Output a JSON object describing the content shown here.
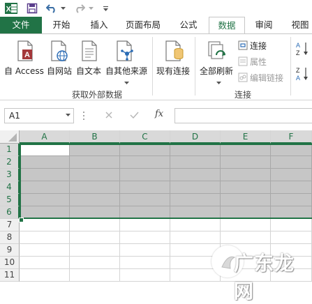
{
  "qat": {
    "icons": [
      "excel-logo-icon",
      "save-icon",
      "undo-icon",
      "redo-icon",
      "customize-dropdown-icon"
    ]
  },
  "tabs": [
    {
      "label": "文件"
    },
    {
      "label": "开始"
    },
    {
      "label": "插入"
    },
    {
      "label": "页面布局"
    },
    {
      "label": "公式"
    },
    {
      "label": "数据"
    },
    {
      "label": "审阅"
    },
    {
      "label": "视图"
    }
  ],
  "active_tab": "数据",
  "ribbon": {
    "get_external": {
      "group_label": "获取外部数据",
      "buttons": [
        {
          "label": "自 Access",
          "icon": "access-db-icon"
        },
        {
          "label": "自网站",
          "icon": "web-page-icon"
        },
        {
          "label": "自文本",
          "icon": "text-file-icon"
        },
        {
          "label": "自其他来源",
          "icon": "other-sources-icon"
        }
      ]
    },
    "existing": {
      "label": "现有连接",
      "icon": "existing-connections-icon"
    },
    "connections": {
      "group_label": "连接",
      "refresh_label": "全部刷新",
      "connect_label": "连接",
      "properties_label": "属性",
      "edit_links_label": "编辑链接"
    },
    "sort": {
      "asc_label": "A↓Z",
      "desc_label": "Z↓A"
    }
  },
  "formula_bar": {
    "name_box": "A1",
    "fx_label": "fx",
    "formula": ""
  },
  "sheet": {
    "columns": [
      "A",
      "B",
      "C",
      "D",
      "E",
      "F"
    ],
    "rows": [
      "1",
      "2",
      "3",
      "4",
      "5",
      "6",
      "7",
      "8",
      "9",
      "10",
      "11"
    ],
    "selected_range": "A1:F6",
    "active_cell": "A1"
  },
  "watermark": {
    "text": "广东龙网"
  },
  "colors": {
    "accent": "#217346",
    "selection_fill": "#c6c6c6"
  }
}
